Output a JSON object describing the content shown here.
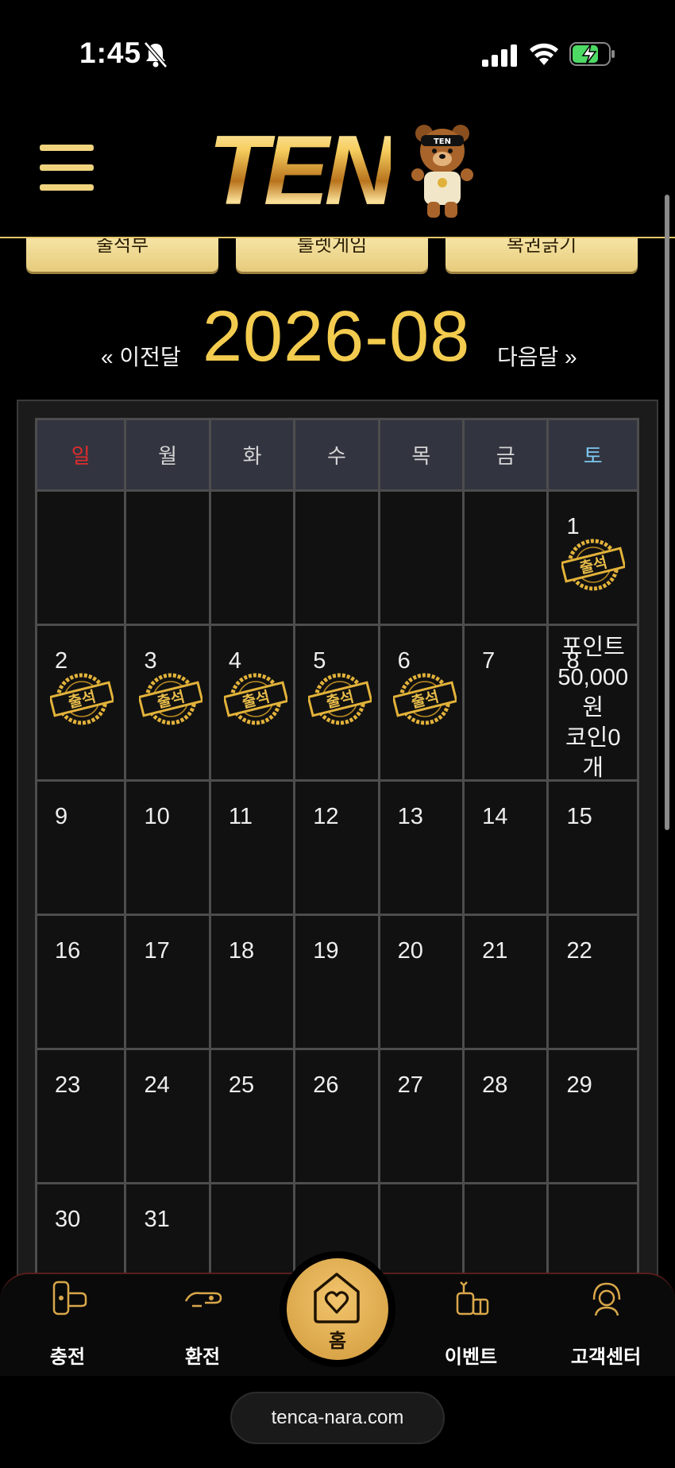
{
  "status_bar": {
    "time": "1:45"
  },
  "header": {
    "logo_text": "TEN",
    "bear_cap": "TEN"
  },
  "tabs": [
    "출석부",
    "룰렛게임",
    "복권긁기"
  ],
  "month_nav": {
    "prev": "« 이전달",
    "title": "2026-08",
    "next": "다음달 »"
  },
  "calendar": {
    "weekdays": [
      "일",
      "월",
      "화",
      "수",
      "목",
      "금",
      "토"
    ],
    "stamp_label": "출석",
    "reward": [
      "포인트",
      "50,000",
      "원",
      "코인0",
      "개"
    ],
    "days": [
      "1",
      "2",
      "3",
      "4",
      "5",
      "6",
      "7",
      "8",
      "9",
      "10",
      "11",
      "12",
      "13",
      "14",
      "15",
      "16",
      "17",
      "18",
      "19",
      "20",
      "21",
      "22",
      "23",
      "24",
      "25",
      "26",
      "27",
      "28",
      "29",
      "30",
      "31"
    ],
    "attended_days": [
      1,
      2,
      3,
      4,
      5,
      6
    ]
  },
  "bottom_nav": {
    "charge": "충전",
    "exchange": "환전",
    "home": "홈",
    "event": "이벤트",
    "support": "고객센터"
  },
  "browser": {
    "url": "tenca-nara.com"
  },
  "colors": {
    "gold": "#f3cc4f",
    "sunday": "#e02c2c",
    "saturday": "#7cc6f0"
  }
}
